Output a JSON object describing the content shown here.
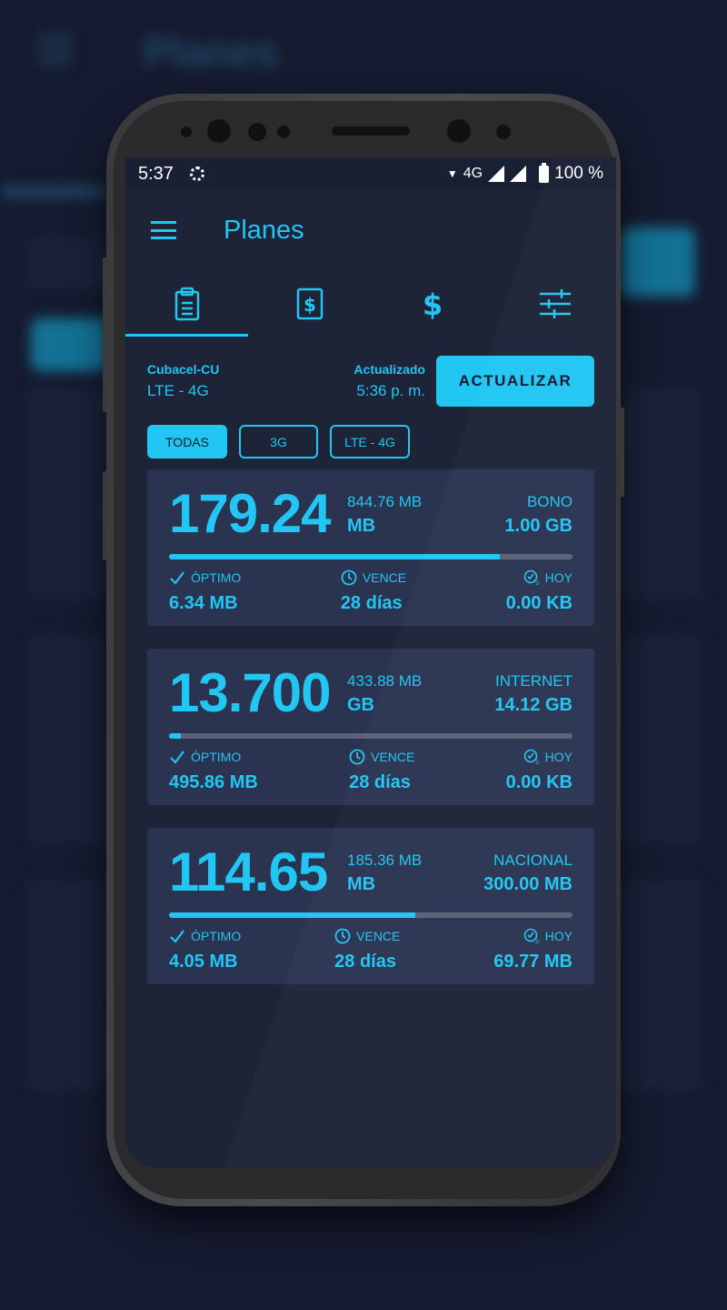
{
  "backdrop": {
    "title": "Planes"
  },
  "status": {
    "time": "5:37",
    "network": "4G",
    "battery": "100 %"
  },
  "appbar": {
    "title": "Planes"
  },
  "tabs": [
    {
      "name": "plans",
      "icon": "clipboard-icon",
      "active": true
    },
    {
      "name": "recharge",
      "icon": "card-dollar-icon",
      "active": false
    },
    {
      "name": "balance",
      "icon": "dollar-icon",
      "active": false
    },
    {
      "name": "settings",
      "icon": "sliders-icon",
      "active": false
    }
  ],
  "info": {
    "operator": "Cubacel-CU",
    "network": "LTE - 4G",
    "updated_label": "Actualizado",
    "updated_time": "5:36 p. m.",
    "update_button": "ACTUALIZAR"
  },
  "filters": [
    "TODAS",
    "3G",
    "LTE - 4G"
  ],
  "cards": [
    {
      "main": "179.24",
      "sub_value": "844.76 MB",
      "sub_unit": "MB",
      "category": "BONO",
      "category_value": "1.00 GB",
      "progress": 0.82,
      "optimo_label": "ÓPTIMO",
      "optimo_value": "6.34 MB",
      "vence_label": "VENCE",
      "vence_value": "28 días",
      "hoy_label": "HOY",
      "hoy_value": "0.00 KB"
    },
    {
      "main": "13.700",
      "sub_value": "433.88 MB",
      "sub_unit": "GB",
      "category": "INTERNET",
      "category_value": "14.12 GB",
      "progress": 0.03,
      "optimo_label": "ÓPTIMO",
      "optimo_value": "495.86 MB",
      "vence_label": "VENCE",
      "vence_value": "28 días",
      "hoy_label": "HOY",
      "hoy_value": "0.00 KB"
    },
    {
      "main": "114.65",
      "sub_value": "185.36 MB",
      "sub_unit": "MB",
      "category": "NACIONAL",
      "category_value": "300.00 MB",
      "progress": 0.61,
      "optimo_label": "ÓPTIMO",
      "optimo_value": "4.05 MB",
      "vence_label": "VENCE",
      "vence_value": "28 días",
      "hoy_label": "HOY",
      "hoy_value": "69.77 MB"
    }
  ],
  "colors": {
    "accent": "#21c6f3",
    "background": "#1e2438",
    "card": "#2a3350",
    "track": "#5a6178"
  }
}
